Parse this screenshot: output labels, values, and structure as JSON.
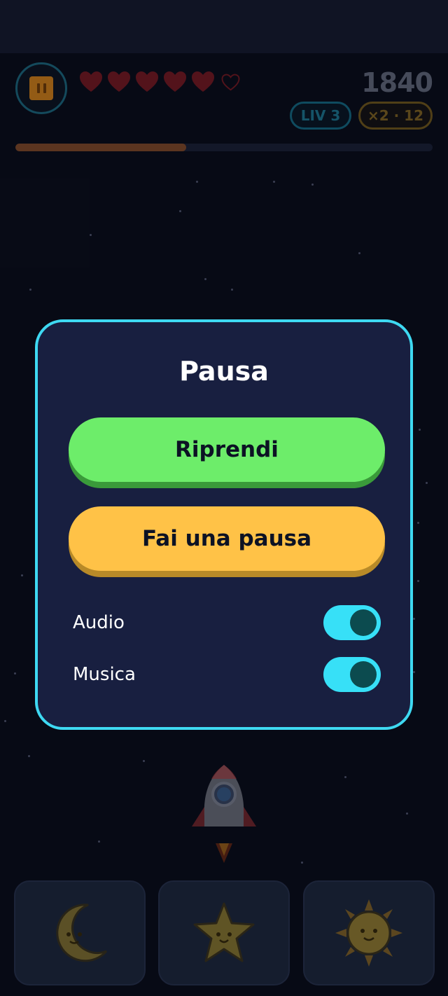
{
  "hud": {
    "score": "1840",
    "level_label": "LIV 3",
    "combo_label": "×2 · 12",
    "lives_total": 6,
    "lives_filled": 5,
    "progress_fraction": 0.41,
    "colors": {
      "heart": "#e0282c",
      "accent_cyan": "#3ed9f2",
      "progress": "#8a4f2a"
    }
  },
  "icons": {
    "pause": "pause-icon",
    "heart": "heart-icon",
    "rocket": "rocket-icon",
    "moon": "moon-icon",
    "star": "star-icon",
    "sun": "sun-icon"
  },
  "pause_menu": {
    "title": "Pausa",
    "resume_label": "Riprendi",
    "break_label": "Fai una pausa",
    "settings": [
      {
        "label": "Audio",
        "on": true
      },
      {
        "label": "Musica",
        "on": true
      }
    ],
    "colors": {
      "resume": "#6ded6a",
      "break": "#ffc247",
      "toggle_on": "#37e0f7",
      "panel": "#181f40"
    }
  }
}
